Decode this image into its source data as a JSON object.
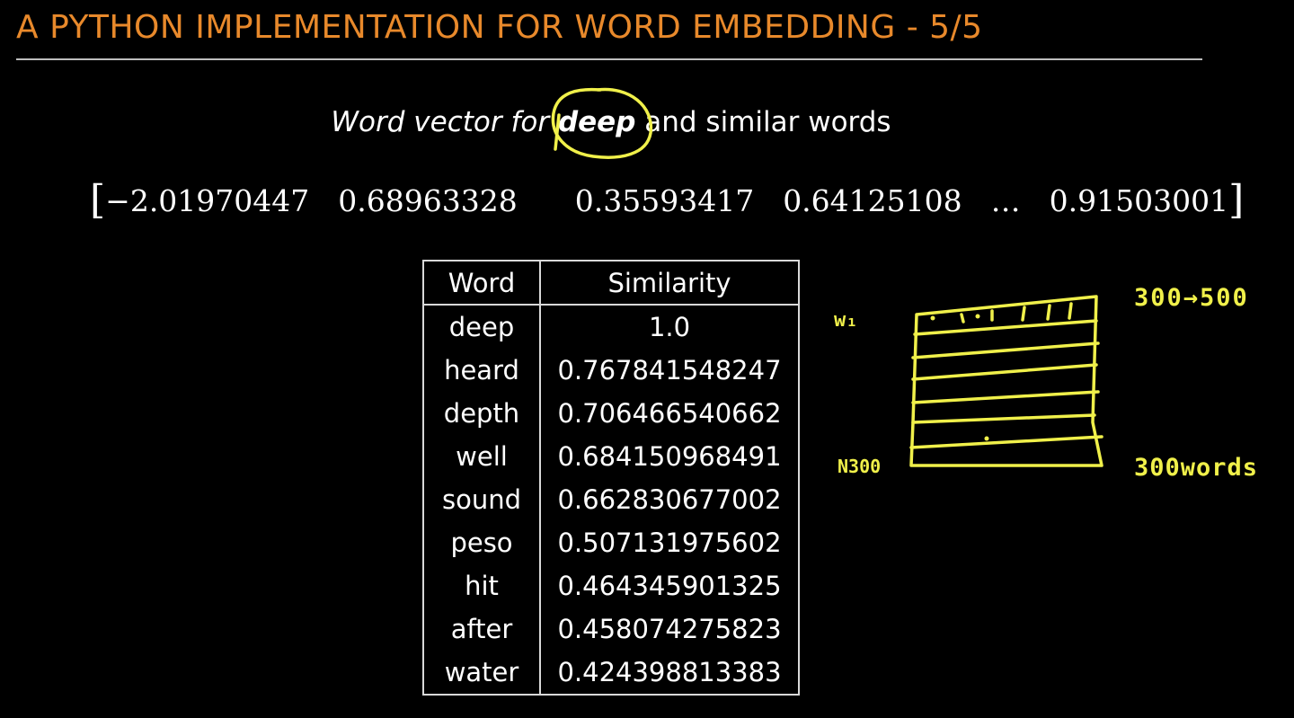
{
  "slide": {
    "title": "A PYTHON IMPLEMENTATION FOR WORD EMBEDDING - 5/5",
    "subtitle_prefix": "Word vector for ",
    "subtitle_word": "deep",
    "subtitle_suffix": " and similar words",
    "vector": {
      "open": "[",
      "close": "]",
      "values": [
        "−2.01970447",
        "0.68963328",
        "0.35593417",
        "0.64125108",
        "…",
        "0.91503001"
      ]
    },
    "table": {
      "headers": [
        "Word",
        "Similarity"
      ],
      "rows": [
        {
          "word": "deep",
          "similarity": "1.0"
        },
        {
          "word": "heard",
          "similarity": "0.767841548247"
        },
        {
          "word": "depth",
          "similarity": "0.706466540662"
        },
        {
          "word": "well",
          "similarity": "0.684150968491"
        },
        {
          "word": "sound",
          "similarity": "0.662830677002"
        },
        {
          "word": "peso",
          "similarity": "0.507131975602"
        },
        {
          "word": "hit",
          "similarity": "0.464345901325"
        },
        {
          "word": "after",
          "similarity": "0.458074275823"
        },
        {
          "word": "water",
          "similarity": "0.424398813383"
        }
      ]
    },
    "annotations": {
      "w1": "w₁",
      "n300": "N300",
      "dims": "300→500",
      "words": "300words"
    },
    "colors": {
      "title": "#e8892b",
      "ink": "#f0f04a",
      "rule": "#bdbdbd"
    }
  }
}
